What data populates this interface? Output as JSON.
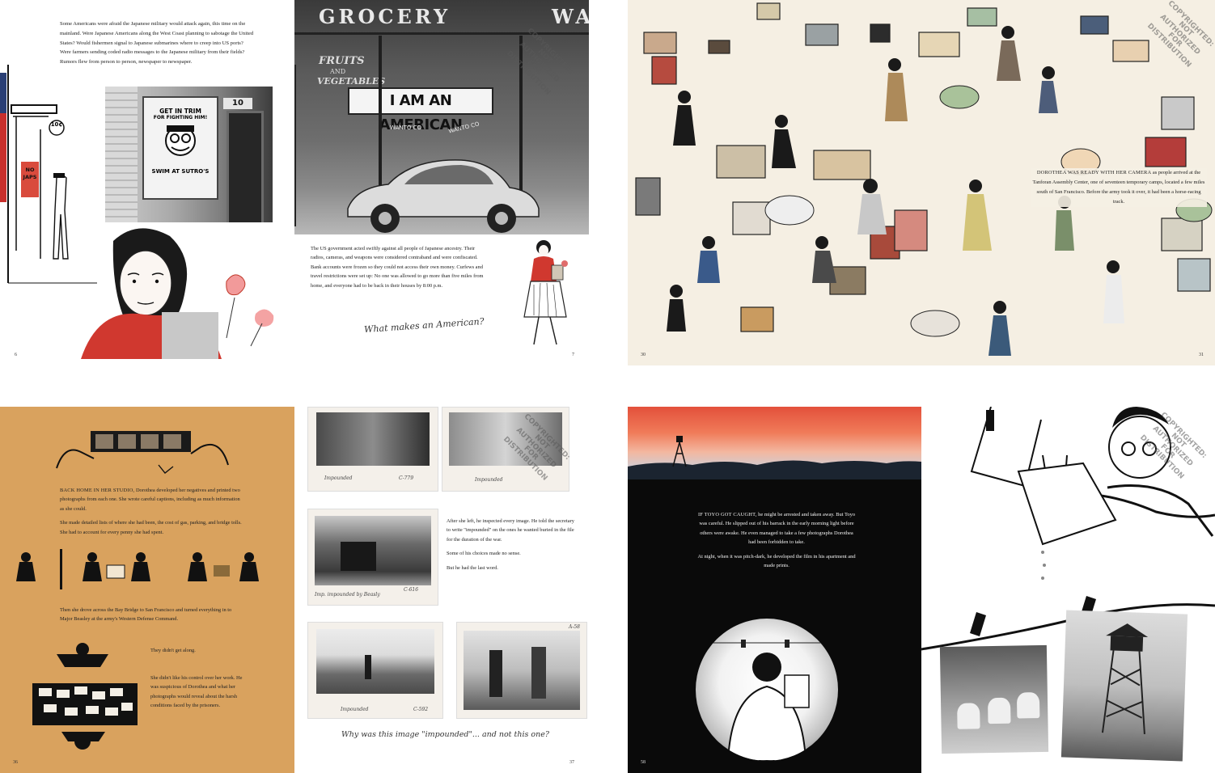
{
  "spread1": {
    "left_paragraph": "Some Americans were afraid the Japanese military would attack again, this time on the mainland. Were Japanese Americans along the West Coast planning to sabotage the United States? Would fishermen signal to Japanese submarines where to creep into US ports? Were farmers sending coded radio messages to the Japanese military from their fields? Rumors flew from person to person, newspaper to newspaper.",
    "poster_line1": "GET IN TRIM",
    "poster_line2": "FOR FIGHTING HIM!",
    "poster_line3": "SWIM AT SUTRO'S",
    "sign_text": "NO JAPS",
    "door_number": "10",
    "shop_price": "10¢",
    "page_left": "6",
    "store_word1": "GROCERY",
    "store_word2": "WAN",
    "window_fruits": "FRUITS",
    "window_and": "AND",
    "window_vegetables": "VEGETABLES",
    "banner": "I AM AN AMERICAN",
    "window_wanto_a": "WANTO CO",
    "window_wanto_b": "WANTO CO",
    "right_paragraph": "The US government acted swiftly against all people of Japanese ancestry. Their radios, cameras, and weapons were considered contraband and were confiscated. Bank accounts were frozen so they could not access their own money. Curfews and travel restrictions were set up: No one was allowed to go more than five miles from home, and everyone had to be back in their houses by 8:00 p.m.",
    "script_question": "What makes an American?",
    "page_right": "7",
    "watermark": "COPYRIGHTED:\nNOT AUTHORIZED\nFOR DISTRIBUTION"
  },
  "spread2": {
    "lead": "DOROTHEA WAS READY WITH HER CAMERA",
    "paragraph": "as people arrived at the Tanforan Assembly Center, one of seventeen temporary camps, located a few miles south of San Francisco. Before the army took it over, it had been a horse-racing track.",
    "page_left": "30",
    "page_right": "31",
    "watermark": "COPYRIGHTED:\nNOT AUTHORIZED\nFOR DISTRIBUTION"
  },
  "spread3": {
    "lead": "BACK HOME IN HER STUDIO,",
    "para1": "Dorothea developed her negatives and printed two photographs from each one. She wrote careful captions, including as much information as she could.",
    "para2": "She made detailed lists of where she had been, the cost of gas, parking, and bridge tolls. She had to account for every penny she had spent.",
    "para3": "Then she drove across the Bay Bridge to San Francisco and turned everything in to Major Beasley at the army's Western Defense Command.",
    "para4": "They didn't get along.",
    "para5": "She didn't like his control over her work. He was suspicious of Dorothea and what her photographs would reveal about the harsh conditions faced by the prisoners.",
    "page_left": "36",
    "caption1": "Impounded",
    "code1": "C-779",
    "caption2": "Impounded",
    "caption3": "Imp. impounded by Beasly",
    "code3": "C-616",
    "right_p1": "After she left, he inspected every image. He told the secretary to write \"impounded\" on the ones he wanted buried in the file for the duration of the war.",
    "right_p2": "Some of his choices made no sense.",
    "right_p3": "But he had the last word.",
    "caption4": "Impounded",
    "code4": "C-592",
    "code5": "A-58",
    "script_question": "Why was this image \"impounded\"... and not this one?",
    "page_right": "37",
    "watermark": "COPYRIGHTED:\nNOT AUTHORIZED\nFOR DISTRIBUTION"
  },
  "spread4": {
    "lead": "IF TOYO GOT CAUGHT,",
    "para1": "he might be arrested and taken away. But Toyo was careful. He slipped out of his barrack in the early morning light before others were awake. He even managed to take a few photographs Dorothea had been forbidden to take.",
    "para2": "At night, when it was pitch-dark, he developed the film in his apartment and made prints.",
    "page_left": "58",
    "watermark": "COPYRIGHTED:\nNOT AUTHORIZED\nFOR DISTRIBUTION"
  },
  "colors": {
    "ochre": "#D9A25E",
    "cream": "#F5EFE3",
    "sky_red": "#E3503B",
    "black": "#0A0A0A",
    "accent_red": "#D0382F"
  }
}
